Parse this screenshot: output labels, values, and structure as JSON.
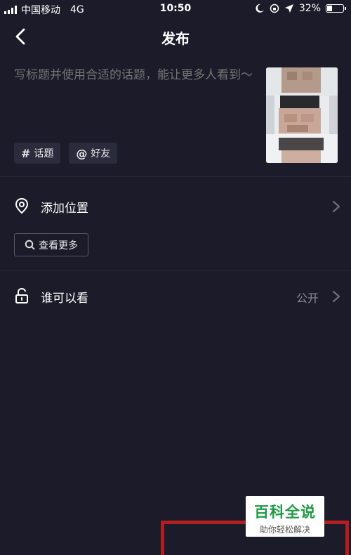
{
  "status_bar": {
    "carrier": "中国移动",
    "network": "4G",
    "time": "10:50",
    "battery": "32%",
    "battery_level": 0.32
  },
  "nav": {
    "title": "发布",
    "back_icon": "chevron-left-icon"
  },
  "caption": {
    "placeholder": "写标题并使用合适的话题，能让更多人看到～"
  },
  "tags": [
    {
      "symbol": "#",
      "label": "话题"
    },
    {
      "symbol": "@",
      "label": "好友"
    }
  ],
  "location": {
    "icon": "location-pin-icon",
    "label": "添加位置",
    "more_label": "查看更多"
  },
  "privacy": {
    "icon": "unlock-icon",
    "label": "谁可以看",
    "value": "公开"
  },
  "watermark": {
    "title": "百科全说",
    "subtitle": "助你轻松解决"
  },
  "colors": {
    "background": "#1b1b2a",
    "muted_text": "#8a8b95",
    "highlight_border": "#b41e1e",
    "watermark_green": "#1f9a45"
  }
}
